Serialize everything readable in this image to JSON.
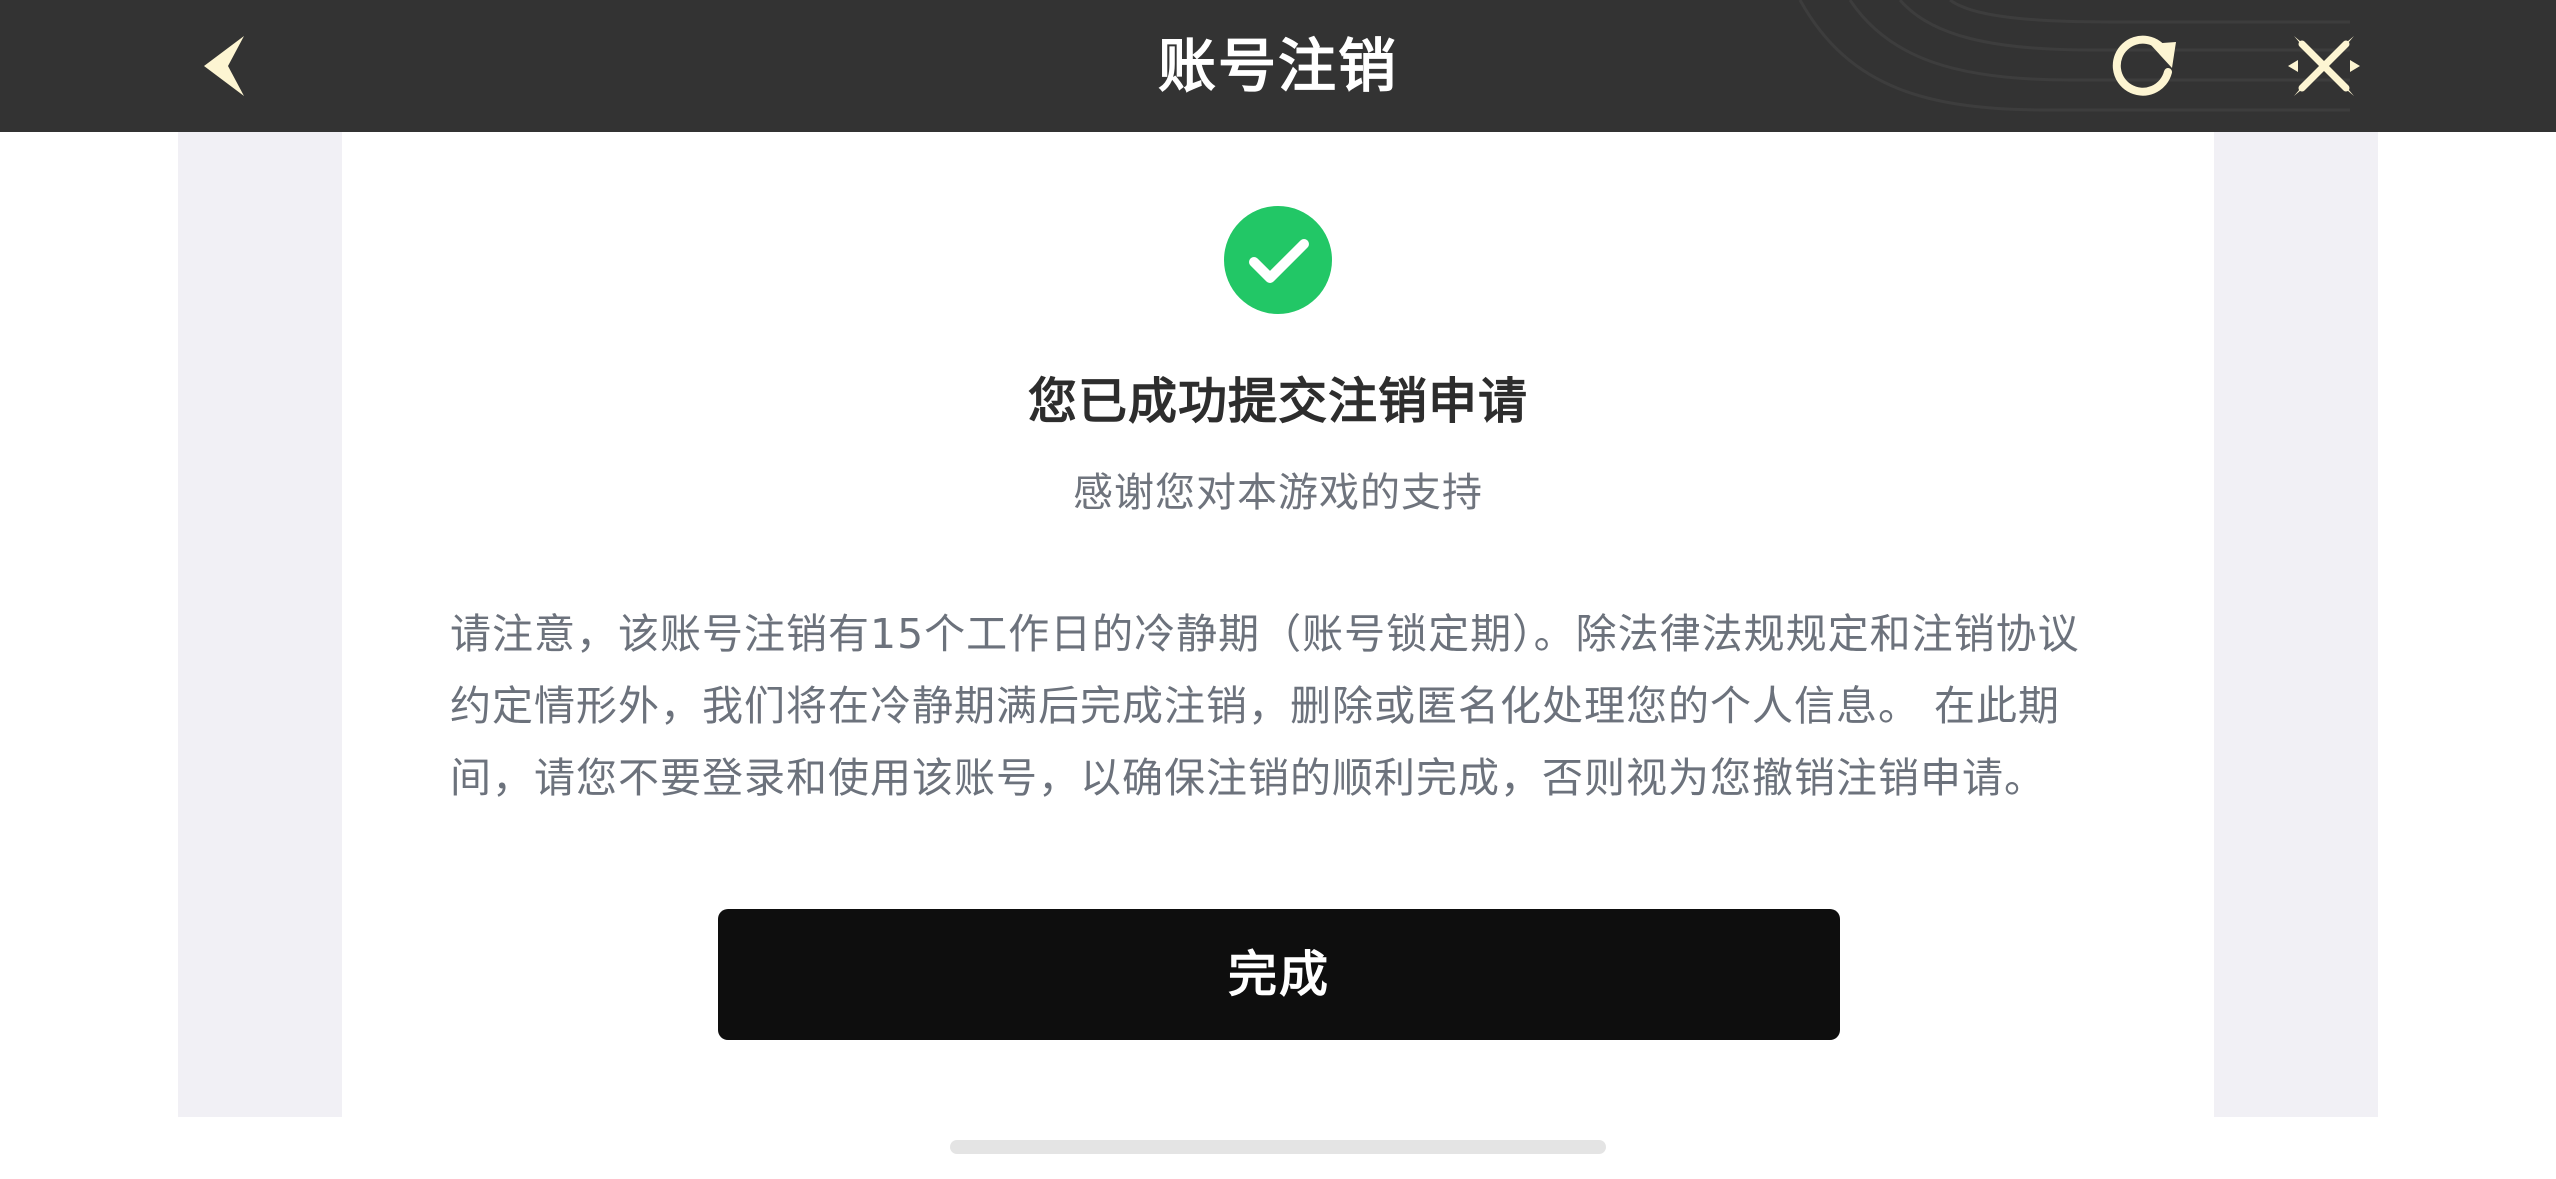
{
  "header": {
    "title": "账号注销",
    "icons": {
      "back": "chevron-left-icon",
      "refresh": "refresh-icon",
      "close": "close-cross-icon"
    }
  },
  "result": {
    "status_icon": "check-circle-icon",
    "title": "您已成功提交注销申请",
    "subtitle": "感谢您对本游戏的支持",
    "notice": "请注意，该账号注销有15个工作日的冷静期（账号锁定期）。除法律法规规定和注销协议约定情形外，我们将在冷静期满后完成注销，删除或匿名化处理您的个人信息。 在此期间，请您不要登录和使用该账号，以确保注销的顺利完成，否则视为您撤销注销申请。",
    "done_button": "完成"
  },
  "colors": {
    "topbar": "#333333",
    "icon_accent": "#fdf5d2",
    "success": "#22c766",
    "button": "#0e0e0e",
    "side_panel": "#f1f0f5"
  }
}
